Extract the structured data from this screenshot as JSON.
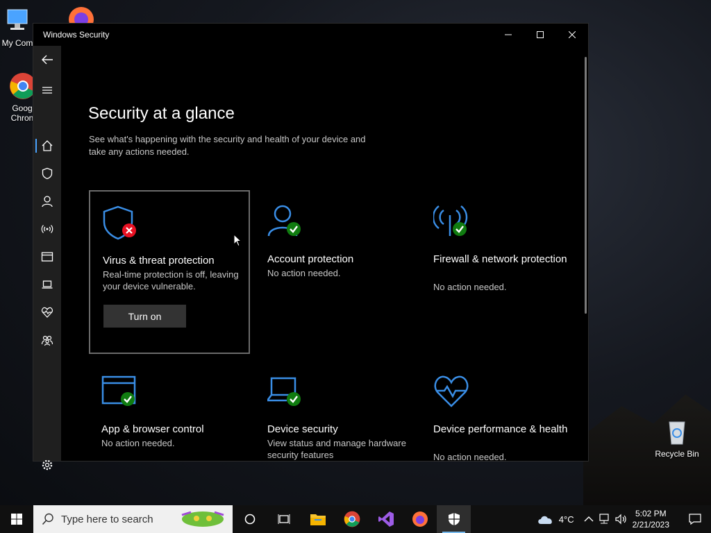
{
  "desktop": {
    "icons": [
      {
        "label": "My Com"
      },
      {
        "label": "Goog Chron"
      },
      {
        "label": "Recycle Bin"
      }
    ]
  },
  "window": {
    "title": "Windows Security",
    "controls": {
      "minimize": "—",
      "maximize": "☐",
      "close": "✕"
    }
  },
  "sidebar": {
    "items": [
      "back",
      "menu",
      "home",
      "virus-protection",
      "account-protection",
      "firewall",
      "app-browser",
      "device-security",
      "device-performance",
      "family-options",
      "settings"
    ],
    "active": "home"
  },
  "main": {
    "title": "Security at a glance",
    "subtitle": "See what's happening with the security and health of your device and take any actions needed.",
    "cards": [
      {
        "title": "Virus & threat protection",
        "desc": "Real-time protection is off, leaving your device vulnerable.",
        "status": "error",
        "button": "Turn on"
      },
      {
        "title": "Account protection",
        "desc": "No action needed.",
        "status": "ok"
      },
      {
        "title": "Firewall & network protection",
        "desc": "No action needed.",
        "status": "ok"
      },
      {
        "title": "App & browser control",
        "desc": "No action needed.",
        "status": "ok"
      },
      {
        "title": "Device security",
        "desc": "View status and manage hardware security features",
        "status": "ok"
      },
      {
        "title": "Device performance & health",
        "desc": "No action needed.",
        "status": "ok"
      }
    ]
  },
  "taskbar": {
    "search_placeholder": "Type here to search",
    "apps": [
      "cortana",
      "task-view",
      "file-explorer",
      "chrome",
      "visual-studio",
      "firefox",
      "windows-security"
    ],
    "weather": "4°C",
    "time": "5:02 PM",
    "date": "2/21/2023"
  },
  "colors": {
    "accent_blue": "#3a8ee6",
    "ok_green": "#107c10",
    "error_red": "#e81123",
    "sidebar_bg": "#1f1f1f"
  }
}
